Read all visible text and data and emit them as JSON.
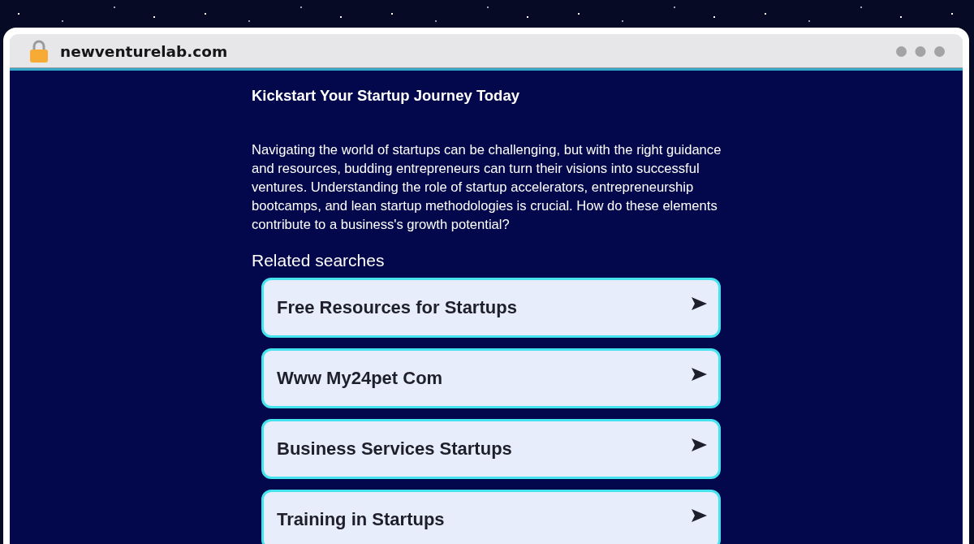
{
  "browser": {
    "url": "newventurelab.com"
  },
  "page": {
    "heading": "Kickstart Your Startup Journey Today",
    "intro": "Navigating the world of startups can be challenging, but with the right guidance and resources, budding entrepreneurs can turn their visions into successful ventures. Understanding the role of startup accelerators, entrepreneurship bootcamps, and lean startup methodologies is crucial. How do these elements contribute to a business's growth potential?",
    "related_heading": "Related searches",
    "related_searches": [
      {
        "label": "Free Resources for Startups"
      },
      {
        "label": "Www My24pet Com"
      },
      {
        "label": "Business Services Startups"
      },
      {
        "label": "Training in Startups"
      }
    ]
  }
}
